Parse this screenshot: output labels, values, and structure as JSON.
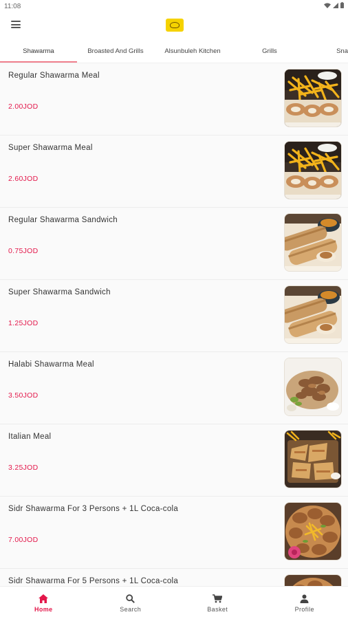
{
  "status_bar": {
    "time": "11:08"
  },
  "tabs": [
    {
      "label": "Shawarma",
      "active": true
    },
    {
      "label": "Broasted And Grills"
    },
    {
      "label": "Alsunbuleh Kitchen"
    },
    {
      "label": "Grills"
    },
    {
      "label": "Sna"
    }
  ],
  "items": [
    {
      "name": "Regular Shawarma Meal",
      "price": "2.00JOD",
      "image": "fries-shawarma"
    },
    {
      "name": "Super Shawarma Meal",
      "price": "2.60JOD",
      "image": "fries-shawarma"
    },
    {
      "name": "Regular Shawarma Sandwich",
      "price": "0.75JOD",
      "image": "sandwich-rolls"
    },
    {
      "name": "Super Shawarma Sandwich",
      "price": "1.25JOD",
      "image": "sandwich-rolls"
    },
    {
      "name": "Halabi Shawarma Meal",
      "price": "3.50JOD",
      "image": "halabi-plate"
    },
    {
      "name": "Italian Meal",
      "price": "3.25JOD",
      "image": "italian-tray"
    },
    {
      "name": "Sidr Shawarma For 3 Persons + 1L Coca-cola",
      "price": "7.00JOD",
      "image": "sidr-platter"
    },
    {
      "name": "Sidr Shawarma For 5 Persons + 1L Coca-cola",
      "price": "",
      "image": "sidr-platter"
    }
  ],
  "bottom_nav": [
    {
      "label": "Home",
      "icon": "home-icon",
      "active": true
    },
    {
      "label": "Search",
      "icon": "search-icon"
    },
    {
      "label": "Basket",
      "icon": "cart-icon"
    },
    {
      "label": "Profile",
      "icon": "person-icon"
    }
  ],
  "colors": {
    "accent": "#e3174a",
    "tab_indicator": "#f07f8d",
    "logo": "#f5d200"
  }
}
